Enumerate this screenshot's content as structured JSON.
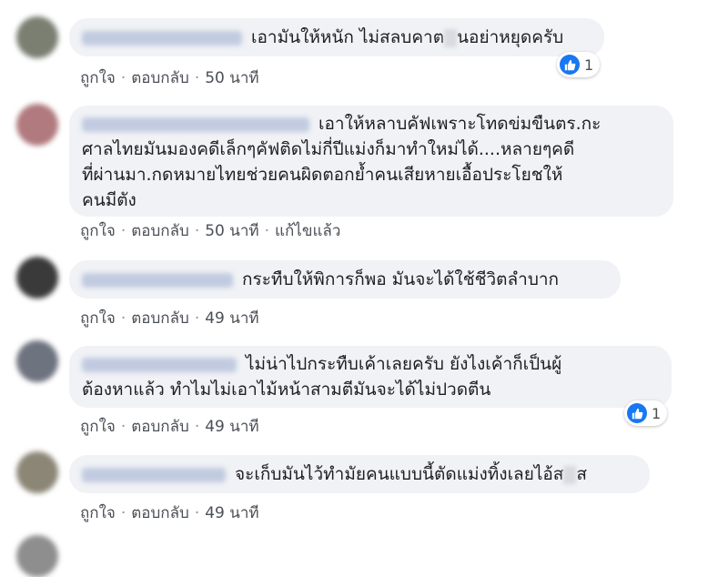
{
  "actions": {
    "like": "ถูกใจ",
    "reply": "ตอบกลับ",
    "separator": "·"
  },
  "comments": [
    {
      "text_a": "เอามันให้หนัก ไม่สลบคาต",
      "text_b": "นอย่าหยุดครับ",
      "time": "50 นาที",
      "likes": "1",
      "avatar_color": "#7a7f72"
    },
    {
      "lines": [
        "เอาให้หลาบคัฟเพราะโทดข่มขืนตร.กะ",
        "ศาลไทยมันมองคดีเล็กๆคัฟติดไม่กี่ปีแม่งก็มาทำใหม่ได้....หลายๆคดี",
        "ที่ผ่านมา.กดหมายไทยช่วยคนผิดตอกย้ำคนเสียหายเอื้อประโยชให้",
        "คนมีตัง"
      ],
      "time": "50 นาที",
      "edited": "แก้ไขแล้ว",
      "avatar_color": "#b07a7e"
    },
    {
      "text": "กระทืบให้พิการก็พอ มันจะได้ใช้ชีวิตลำบาก",
      "time": "49 นาที",
      "avatar_color": "#3a3a3a"
    },
    {
      "lines": [
        "ไม่น่าไปกระทืบเค้าเลยครับ ยังไงเค้าก็เป็นผู้",
        "ต้องหาแล้ว ทำไมไม่เอาไม้หน้าสามตีมันจะได้ไม่ปวดตีน"
      ],
      "time": "49 นาที",
      "likes": "1",
      "avatar_color": "#6e7380"
    },
    {
      "text_a": "จะเก็บมันไว้ทำมัยคนแบบนี้ตัดแม่งทิ้งเลยไอ้ส",
      "text_b": "ส",
      "time": "49 นาที",
      "avatar_color": "#8c8676"
    }
  ]
}
